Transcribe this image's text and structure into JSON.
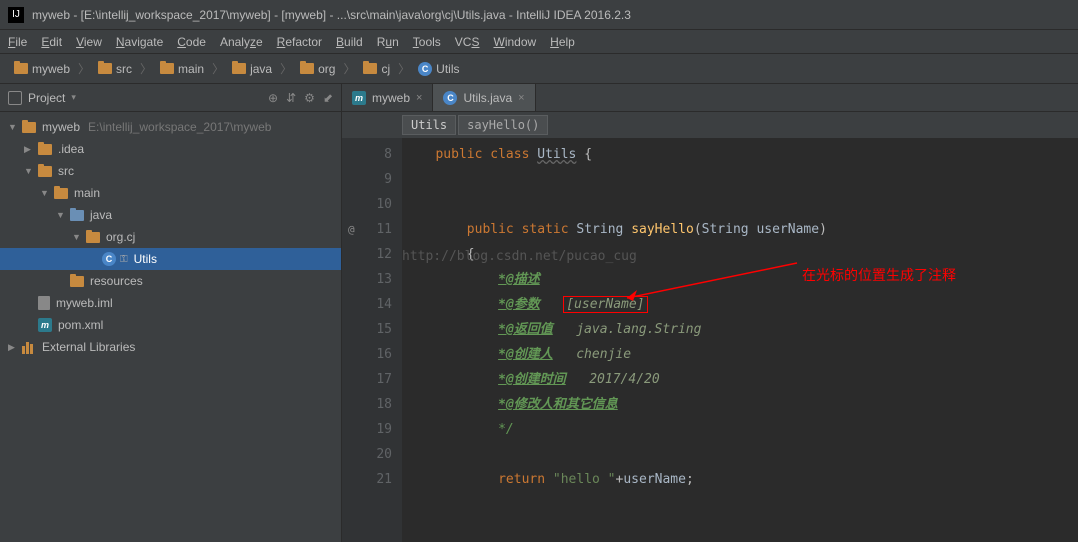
{
  "title": "myweb - [E:\\intellij_workspace_2017\\myweb] - [myweb] - ...\\src\\main\\java\\org\\cj\\Utils.java - IntelliJ IDEA 2016.2.3",
  "menu": {
    "file": "File",
    "edit": "Edit",
    "view": "View",
    "navigate": "Navigate",
    "code": "Code",
    "analyze": "Analyze",
    "refactor": "Refactor",
    "build": "Build",
    "run": "Run",
    "tools": "Tools",
    "vcs": "VCS",
    "window": "Window",
    "help": "Help"
  },
  "breadcrumbs": {
    "items": [
      "myweb",
      "src",
      "main",
      "java",
      "org",
      "cj",
      "Utils"
    ]
  },
  "sidebar": {
    "title": "Project",
    "tree": {
      "root": "myweb",
      "rootPath": "E:\\intellij_workspace_2017\\myweb",
      "idea": ".idea",
      "src": "src",
      "main": "main",
      "java": "java",
      "pkg": "org.cj",
      "utils": "Utils",
      "resources": "resources",
      "iml": "myweb.iml",
      "pom": "pom.xml",
      "extlib": "External Libraries"
    }
  },
  "tabs": {
    "t1": "myweb",
    "t2": "Utils.java"
  },
  "crumbBar": {
    "c1": "Utils",
    "c2": "sayHello()"
  },
  "code": {
    "ln8": "8",
    "ln9": "9",
    "ln10": "10",
    "ln11": "11",
    "ln12": "12",
    "ln13": "13",
    "ln14": "14",
    "ln15": "15",
    "ln16": "16",
    "ln17": "17",
    "ln18": "18",
    "ln19": "19",
    "ln20": "20",
    "ln21": "21",
    "kw_public": "public",
    "kw_class": "class",
    "kw_static": "static",
    "kw_return": "return",
    "cls_Utils": "Utils",
    "type_String": "String",
    "method_sayHello": "sayHello",
    "param_userName": "userName",
    "str_hello": "\"hello \"",
    "c_open": "{",
    "c_close": "}",
    "at": "@",
    "doc_start": "{",
    "doc_desc": "*@描述",
    "doc_param": "*@参数",
    "doc_param_val": "[userName]",
    "doc_return": "*@返回值",
    "doc_return_val": "java.lang.String",
    "doc_author": "*@创建人",
    "doc_author_val": "chenjie",
    "doc_date": "*@创建时间",
    "doc_date_val": "2017/4/20",
    "doc_mod": "*@修改人和其它信息",
    "doc_end": "*/",
    "plus": "+",
    "semi": ";"
  },
  "watermark": "http://blog.csdn.net/pucao_cug",
  "annotation": "在光标的位置生成了注释"
}
